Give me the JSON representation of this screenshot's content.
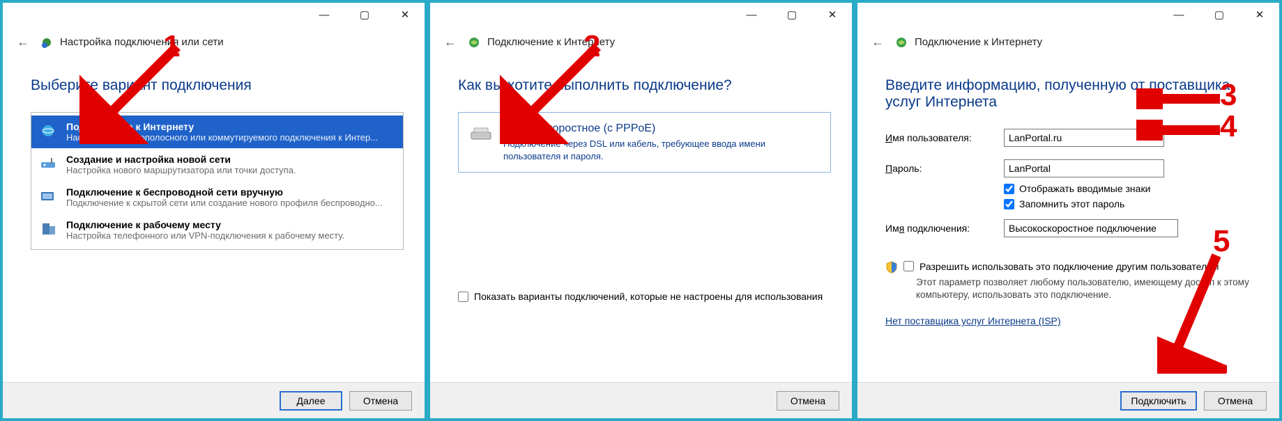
{
  "window1": {
    "title": "Настройка подключения или сети",
    "heading": "Выберите вариант подключения",
    "options": [
      {
        "title": "Подключение к Интернету",
        "desc": "Настройка широкополосного или коммутируемого подключения к Интер..."
      },
      {
        "title": "Создание и настройка новой сети",
        "desc": "Настройка нового маршрутизатора или точки доступа."
      },
      {
        "title": "Подключение к беспроводной сети вручную",
        "desc": "Подключение к скрытой сети или создание нового профиля беспроводно..."
      },
      {
        "title": "Подключение к рабочему месту",
        "desc": "Настройка телефонного или VPN-подключения к рабочему месту."
      }
    ],
    "next": "Далее",
    "cancel": "Отмена"
  },
  "window2": {
    "title": "Подключение к Интернету",
    "heading": "Как вы хотите выполнить подключение?",
    "option_title": "Высокоскоростное (с PPPoE)",
    "option_desc": "Подключение через DSL или кабель, требующее ввода имени пользователя и пароля.",
    "show_unconfigured": "Показать варианты подключений, которые не настроены для использования",
    "cancel": "Отмена"
  },
  "window3": {
    "title": "Подключение к Интернету",
    "heading": "Введите информацию, полученную от поставщика услуг Интернета",
    "username_label": "Имя пользователя:",
    "username_value": "LanPortal.ru",
    "password_label": "Пароль:",
    "password_value": "LanPortal",
    "show_chars": "Отображать вводимые знаки",
    "remember": "Запомнить этот пароль",
    "conn_name_label": "Имя подключения:",
    "conn_name_value": "Высокоскоростное подключение",
    "allow_others": "Разрешить использовать это подключение другим пользователям",
    "allow_others_desc": "Этот параметр позволяет любому пользователю, имеющему доступ к этому компьютеру, использовать это подключение.",
    "no_isp": "Нет поставщика услуг Интернета (ISP)",
    "connect": "Подключить",
    "cancel": "Отмена"
  },
  "annotations": {
    "n1": "1",
    "n2": "2",
    "n3": "3",
    "n4": "4",
    "n5": "5"
  }
}
